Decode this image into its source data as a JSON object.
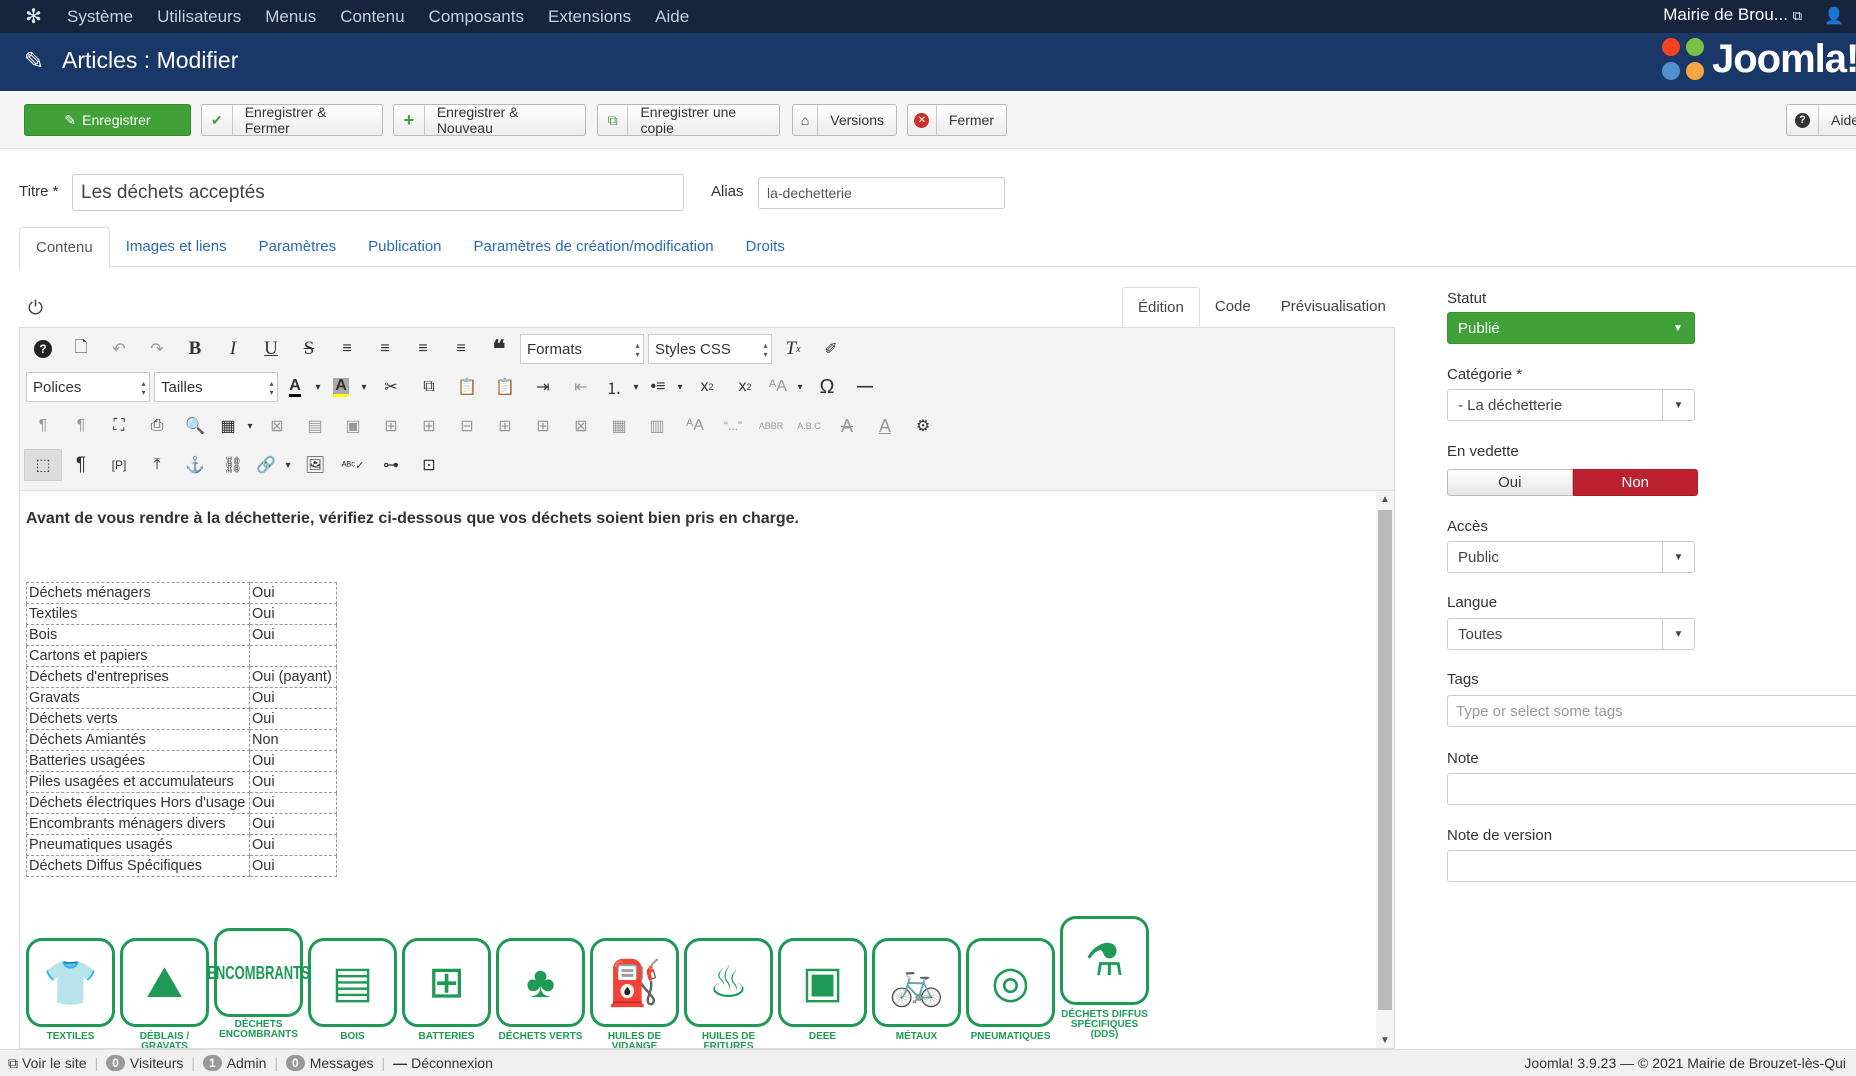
{
  "topnav": {
    "menu": [
      "Système",
      "Utilisateurs",
      "Menus",
      "Contenu",
      "Composants",
      "Extensions",
      "Aide"
    ],
    "site_name": "Mairie de Brou..."
  },
  "header": {
    "title": "Articles : Modifier",
    "brand": "Joomla!"
  },
  "toolbar": {
    "save": "Enregistrer",
    "save_close": "Enregistrer & Fermer",
    "save_new": "Enregistrer & Nouveau",
    "save_copy": "Enregistrer une copie",
    "versions": "Versions",
    "close": "Fermer",
    "help": "Aide"
  },
  "form": {
    "title_label": "Titre *",
    "title_value": "Les déchets acceptés",
    "alias_label": "Alias",
    "alias_value": "la-dechetterie"
  },
  "tabs": [
    "Contenu",
    "Images et liens",
    "Paramètres",
    "Publication",
    "Paramètres de création/modification",
    "Droits"
  ],
  "editor": {
    "tabs": [
      "Édition",
      "Code",
      "Prévisualisation"
    ],
    "formats": "Formats",
    "styles": "Styles CSS",
    "fonts": "Polices",
    "sizes": "Tailles",
    "intro": "Avant de vous rendre à la déchetterie, vérifiez ci-dessous que vos déchets soient bien pris en charge.",
    "table": [
      [
        "Déchets ménagers",
        "Oui"
      ],
      [
        "Textiles",
        "Oui"
      ],
      [
        "Bois",
        "Oui"
      ],
      [
        "Cartons et papiers",
        ""
      ],
      [
        "Déchets d'entreprises",
        "Oui (payant)"
      ],
      [
        "Gravats",
        "Oui"
      ],
      [
        "Déchets verts",
        "Oui"
      ],
      [
        "Déchets Amiantés",
        "Non"
      ],
      [
        "Batteries usagées",
        "Oui"
      ],
      [
        "Piles usagées et accumulateurs",
        "Oui"
      ],
      [
        "Déchets électriques Hors d'usage",
        "Oui"
      ],
      [
        "Encombrants ménagers divers",
        "Oui"
      ],
      [
        "Pneumatiques usagés",
        "Oui"
      ],
      [
        "Déchets Diffus Spécifiques",
        "Oui"
      ]
    ],
    "icon_captions": [
      "TEXTILES",
      "DÉBLAIS / GRAVATS",
      "DÉCHETS ENCOMBRANTS",
      "BOIS",
      "BATTERIES",
      "DÉCHETS VERTS",
      "HUILES DE VIDANGE",
      "HUILES DE FRITURES",
      "DEEE",
      "MÉTAUX",
      "PNEUMATIQUES",
      "DÉCHETS DIFFUS SPÉCIFIQUES (DDS)"
    ],
    "encombrants_label": "ENCOMBRANTS"
  },
  "sidebar": {
    "statut_label": "Statut",
    "statut_value": "Publié",
    "categorie_label": "Catégorie *",
    "categorie_value": "- La déchetterie",
    "vedette_label": "En vedette",
    "vedette_oui": "Oui",
    "vedette_non": "Non",
    "acces_label": "Accès",
    "acces_value": "Public",
    "langue_label": "Langue",
    "langue_value": "Toutes",
    "tags_label": "Tags",
    "tags_placeholder": "Type or select some tags",
    "note_label": "Note",
    "version_note_label": "Note de version"
  },
  "footer": {
    "view_site": "Voir le site",
    "visitors_count": "0",
    "visitors": "Visiteurs",
    "admin_count": "1",
    "admin": "Admin",
    "messages_count": "0",
    "messages": "Messages",
    "logout": "Déconnexion",
    "copyright": "Joomla! 3.9.23 — © 2021 Mairie de Brouzet-lès-Qui"
  },
  "colors": {
    "topnav": "#17243d",
    "header": "#1a3867",
    "green": "#3fa137",
    "red": "#bd2130",
    "recycle_green": "#1e9a54"
  }
}
